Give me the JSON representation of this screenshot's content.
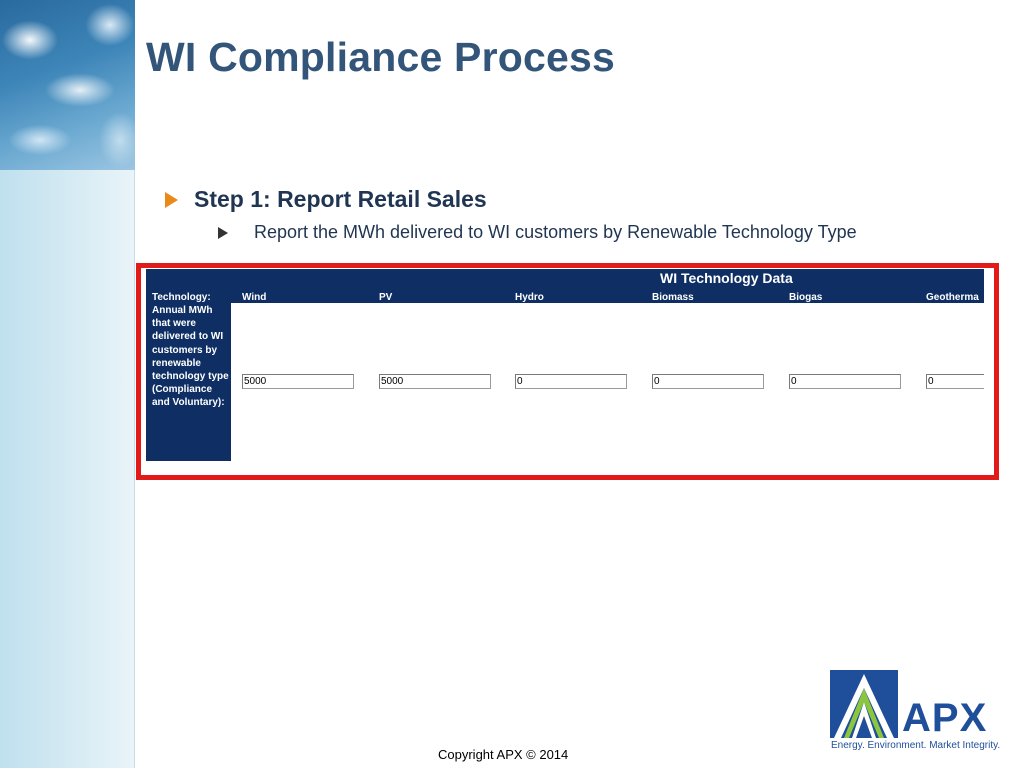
{
  "slide": {
    "title": "WI Compliance Process",
    "bullet_level1": "Step 1: Report Retail Sales",
    "bullet_level2": "Report the MWh delivered to WI customers by Renewable Technology Type",
    "copyright": "Copyright APX © 2014"
  },
  "tech_panel": {
    "title": "WI Technology Data",
    "header_label": "Technology:",
    "row_label": "Annual MWh that were delivered to WI customers by renewable technology type (Compliance and Voluntary):",
    "columns": [
      {
        "label": "Wind",
        "value": "5000"
      },
      {
        "label": "PV",
        "value": "5000"
      },
      {
        "label": "Hydro",
        "value": "0"
      },
      {
        "label": "Biomass",
        "value": "0"
      },
      {
        "label": "Biogas",
        "value": "0"
      },
      {
        "label": "Geotherma",
        "value": "0"
      }
    ]
  },
  "logo": {
    "name": "APX",
    "tagline": "Energy. Environment. Market Integrity."
  },
  "colors": {
    "title": "#34557a",
    "panel_header": "#0f2f64",
    "highlight_frame": "#e11a1a",
    "bullet_arrow": "#e8891a",
    "logo_blue": "#1f4f9a"
  }
}
